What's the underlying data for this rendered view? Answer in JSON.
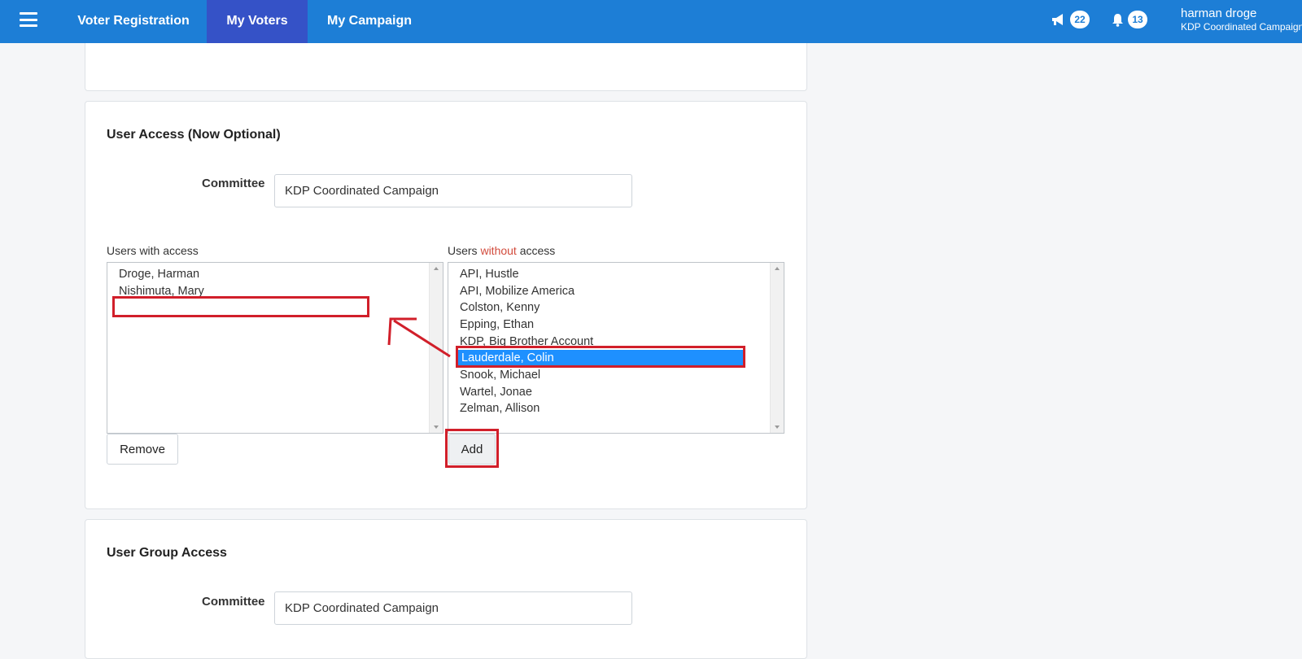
{
  "nav": {
    "tabs": [
      {
        "label": "Voter Registration"
      },
      {
        "label": "My Voters"
      },
      {
        "label": "My Campaign"
      }
    ],
    "announcements_count": "22",
    "notifications_count": "13",
    "user_name": "harman droge",
    "user_org": "KDP Coordinated Campaign"
  },
  "user_access": {
    "title": "User Access (Now Optional)",
    "committee_label": "Committee",
    "committee_value": "KDP Coordinated Campaign",
    "with_access_label": "Users with access",
    "without_label_prefix": "Users ",
    "without_label_word": "without",
    "without_label_suffix": " access",
    "users_with_access": [
      "Droge, Harman",
      "Nishimuta, Mary"
    ],
    "users_without_access": [
      "API, Hustle",
      "API, Mobilize America",
      "Colston, Kenny",
      "Epping, Ethan",
      "KDP, Big Brother Account",
      "Lauderdale, Colin",
      "Snook, Michael",
      "Wartel, Jonae",
      "Zelman, Allison"
    ],
    "selected_user": "Lauderdale, Colin",
    "remove_label": "Remove",
    "add_label": "Add"
  },
  "user_group_access": {
    "title": "User Group Access",
    "committee_label": "Committee",
    "committee_value": "KDP Coordinated Campaign"
  },
  "annotation_color": "#d11f2a",
  "accent_color": "#1d7ed6"
}
